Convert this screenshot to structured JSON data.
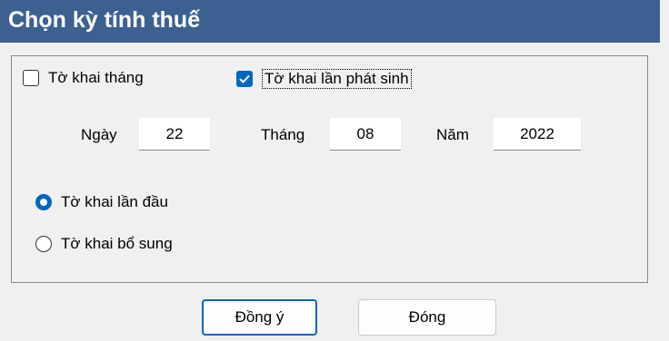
{
  "window": {
    "title": "Chọn kỳ tính thuế"
  },
  "period_type": {
    "monthly_label": "Tờ khai tháng",
    "monthly_checked": false,
    "occurrence_label": "Tờ khai lần phát sinh",
    "occurrence_checked": true
  },
  "date": {
    "day_label": "Ngày",
    "day_value": "22",
    "month_label": "Tháng",
    "month_value": "08",
    "year_label": "Năm",
    "year_value": "2022"
  },
  "declaration_kind": {
    "first_label": "Tờ khai lần đầu",
    "supplementary_label": "Tờ khai bổ sung",
    "selected": "first"
  },
  "buttons": {
    "ok_label": "Đồng ý",
    "close_label": "Đóng"
  },
  "colors": {
    "title_bar": "#3c6190",
    "accent": "#0067c0"
  }
}
